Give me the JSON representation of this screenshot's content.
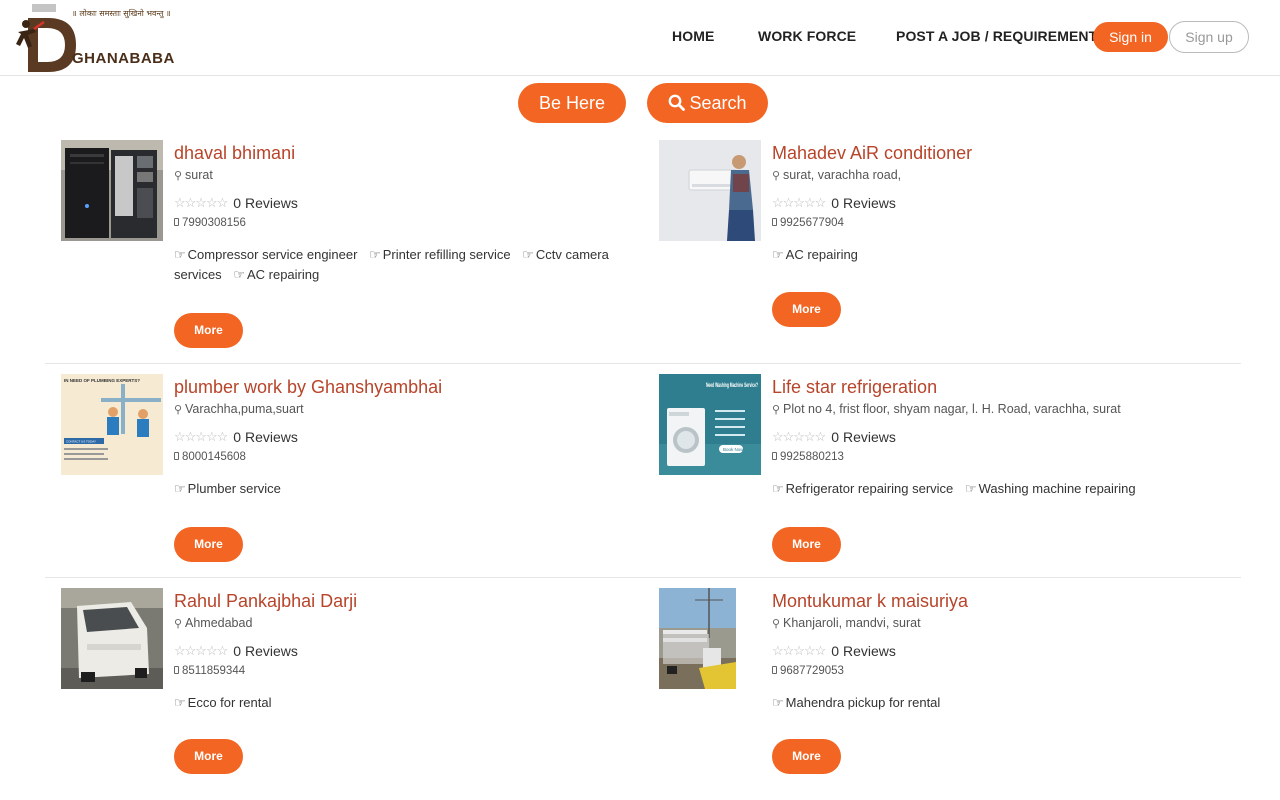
{
  "brand": {
    "tagline": "॥ लोकाः समस्ताः सुखिनो भवन्तु ॥",
    "name": "GHANABABA"
  },
  "nav": {
    "items": [
      {
        "label": "HOME"
      },
      {
        "label": "WORK FORCE"
      },
      {
        "label": "POST A JOB / REQUIREMENT"
      }
    ],
    "sign_in": "Sign in",
    "sign_up": "Sign up"
  },
  "actions": {
    "be_here": "Be Here",
    "search": "Search"
  },
  "colors": {
    "accent": "#f26522",
    "title": "#b8442a"
  },
  "listings": [
    {
      "name": "dhaval bhimani",
      "location": "surat",
      "rating_stars": 0,
      "reviews": "0 Reviews",
      "phone": "7990308156",
      "services": [
        "Compressor service engineer",
        "Printer refilling service",
        "Cctv camera services",
        "AC repairing"
      ],
      "more": "More",
      "thumb_icon": "computer-tower-image"
    },
    {
      "name": "Mahadev AiR conditioner",
      "location": "surat, varachha road,",
      "rating_stars": 0,
      "reviews": "0 Reviews",
      "phone": "9925677904",
      "services": [
        "AC repairing"
      ],
      "more": "More",
      "thumb_icon": "ac-technician-image"
    },
    {
      "name": "plumber work by Ghanshyambhai",
      "location": "Varachha,puma,suart",
      "rating_stars": 0,
      "reviews": "0 Reviews",
      "phone": "8000145608",
      "services": [
        "Plumber service"
      ],
      "more": "More",
      "thumb_icon": "plumbing-poster-image",
      "thumb_text": {
        "headline": "IN NEED OF PLUMBING EXPERTS?",
        "button": "CONTACT US TODAY"
      }
    },
    {
      "name": "Life star refrigeration",
      "location": "Plot no 4, frist floor, shyam nagar, l. H. Road, varachha, surat",
      "rating_stars": 0,
      "reviews": "0 Reviews",
      "phone": "9925880213",
      "services": [
        "Refrigerator repairing service",
        "Washing machine repairing"
      ],
      "more": "More",
      "thumb_icon": "washing-machine-ad-image",
      "thumb_text": {
        "headline": "Need Washing Machine Service?",
        "button": "Book Now"
      }
    },
    {
      "name": "Rahul Pankajbhai Darji",
      "location": "Ahmedabad",
      "rating_stars": 0,
      "reviews": "0 Reviews",
      "phone": "8511859344",
      "services": [
        "Ecco for rental"
      ],
      "more": "More",
      "thumb_icon": "white-van-image"
    },
    {
      "name": "Montukumar k maisuriya",
      "location": "Khanjaroli, mandvi, surat",
      "rating_stars": 0,
      "reviews": "0 Reviews",
      "phone": "9687729053",
      "services": [
        "Mahendra pickup for rental"
      ],
      "more": "More",
      "thumb_icon": "pickup-truck-image"
    }
  ]
}
